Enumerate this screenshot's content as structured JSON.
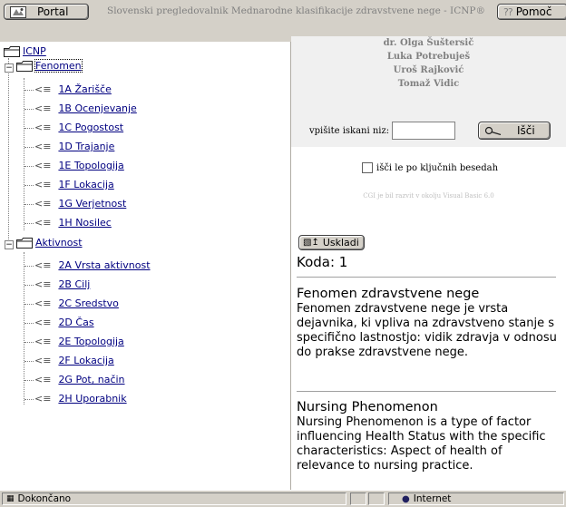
{
  "header": {
    "portal_label": "Portal",
    "title": "Slovenski pregledovalnik Mednarodne klasifikacije zdravstvene nege - ICNP®",
    "help_label": "Pomoč",
    "help_glyph": "??"
  },
  "tree": {
    "root": "ICNP",
    "groups": [
      {
        "label": "Fenomen",
        "items": [
          "1A Žarišče",
          "1B Ocenjevanje",
          "1C Pogostost",
          "1D Trajanje",
          "1E Topologija",
          "1F Lokacija",
          "1G Verjetnost",
          "1H Nosilec"
        ]
      },
      {
        "label": "Aktivnost",
        "items": [
          "2A Vrsta aktivnost",
          "2B Cilj",
          "2C Sredstvo",
          "2D Čas",
          "2E Topologija",
          "2F Lokacija",
          "2G Pot, način",
          "2H Uporabnik"
        ]
      }
    ]
  },
  "authors": [
    "dr. Olga Šuštersič",
    "Luka Potrebuješ",
    "Uroš Rajković",
    "Tomaž Vidic"
  ],
  "search": {
    "label": "vpišite iskani niz:",
    "value": "",
    "button_label": "Išči",
    "keyword_label": "išči le po ključnih besedah",
    "keyword_checked": false,
    "note": "CGI je bil razvit v okolju Visual Basic 6.0"
  },
  "detail": {
    "adjust_label": "Uskladi",
    "code": "Koda: 1",
    "sections": [
      {
        "heading": "Fenomen zdravstvene nege",
        "text": "Fenomen zdravstvene nege je vrsta dejavnika, ki vpliva na zdravstveno stanje s specifično lastnostjo: vidik zdravja v odnosu do prakse zdravstvene nege."
      },
      {
        "heading": "Nursing Phenomenon",
        "text": "Nursing Phenomenon is a type of factor influencing Health Status with the specific characteristics: Aspect of health of relevance to nursing practice."
      }
    ]
  },
  "statusbar": {
    "status": "Dokončano",
    "zone": "Internet"
  },
  "colors": {
    "chrome": "#d4d0c8",
    "link": "#000080",
    "muted": "#808080"
  }
}
